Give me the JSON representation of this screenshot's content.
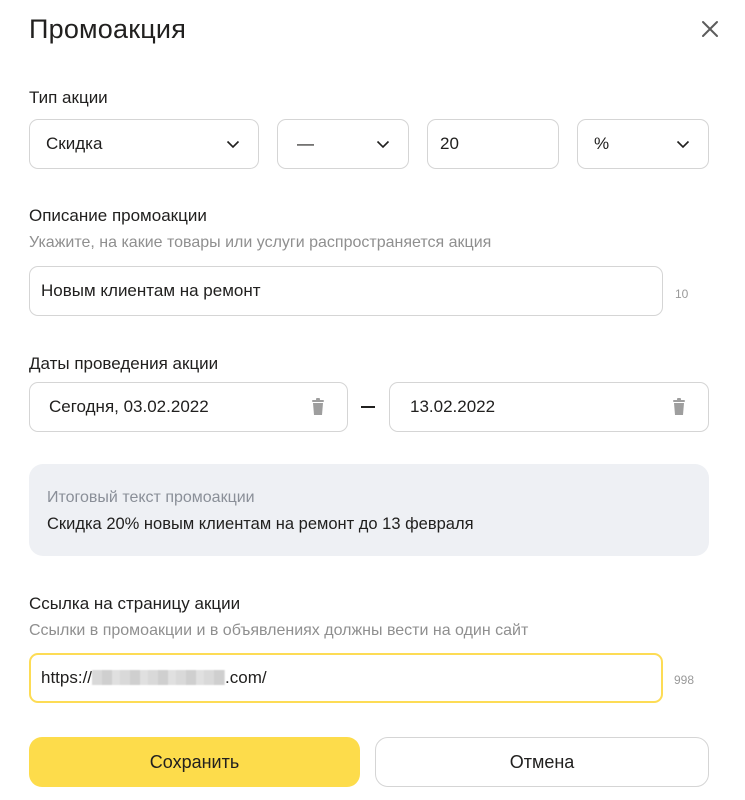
{
  "dialog": {
    "title": "Промоакция"
  },
  "promo_type": {
    "label": "Тип акции",
    "kind": "Скидка",
    "modifier": "—",
    "amount": "20",
    "unit": "%"
  },
  "description": {
    "label": "Описание промоакции",
    "hint": "Укажите, на какие товары или услуги распространяется акция",
    "value": "Новым клиентам на ремонт",
    "counter": "10"
  },
  "dates": {
    "label": "Даты проведения акции",
    "start": "Сегодня, 03.02.2022",
    "end": "13.02.2022"
  },
  "summary": {
    "label": "Итоговый текст промоакции",
    "text": "Скидка 20% новым клиентам на ремонт до 13 февраля"
  },
  "link": {
    "label": "Ссылка на страницу акции",
    "hint": "Ссылки в промоакции и в объявлениях должны вести на один сайт",
    "prefix": "https://",
    "suffix": ".com/",
    "counter": "998"
  },
  "actions": {
    "save": "Сохранить",
    "cancel": "Отмена"
  },
  "colors": {
    "accent": "#fddc4b",
    "focus_border": "#fddc55",
    "summary_bg": "#eef0f4"
  },
  "icons": {
    "close": "close-icon",
    "chevron": "chevron-down-icon",
    "trash": "trash-icon"
  }
}
